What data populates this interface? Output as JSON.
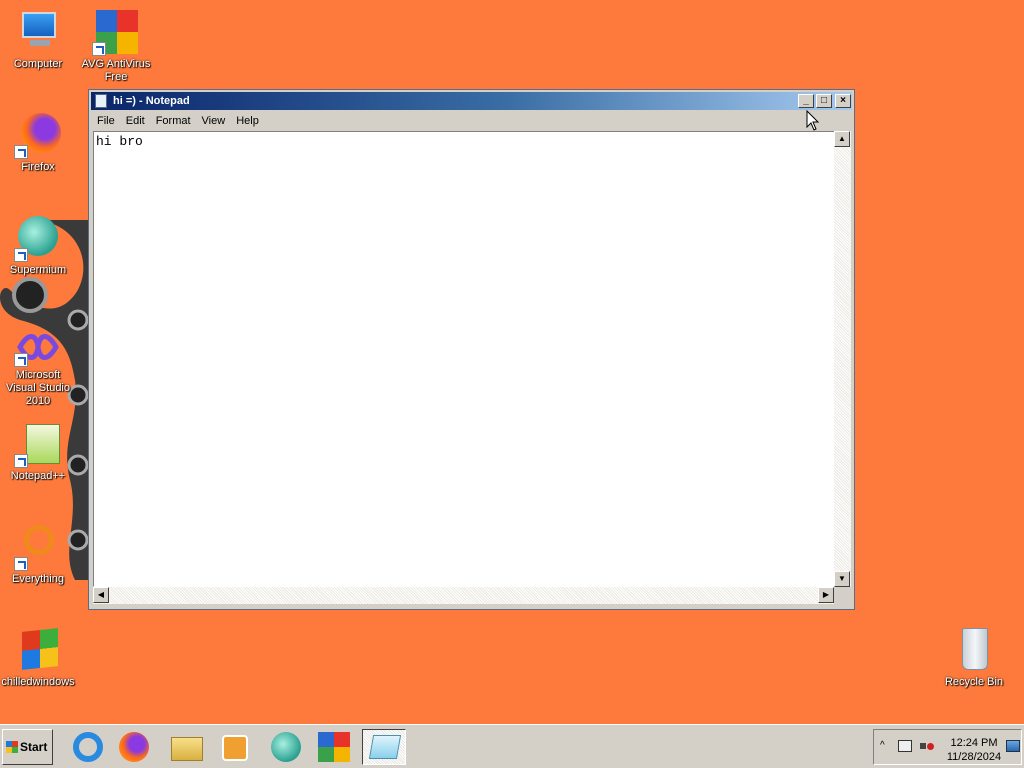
{
  "desktop": {
    "icons_left": [
      {
        "label": "Computer",
        "icon": "computer-icon"
      },
      {
        "label": "Firefox",
        "icon": "firefox-icon"
      },
      {
        "label": "Supermium",
        "icon": "supermium-icon"
      },
      {
        "label": "Microsoft Visual Studio 2010",
        "icon": "visual-studio-icon"
      },
      {
        "label": "Notepad++",
        "icon": "notepadpp-icon"
      },
      {
        "label": "Everything",
        "icon": "everything-icon"
      },
      {
        "label": "chilledwindows",
        "icon": "windows-flag-icon"
      }
    ],
    "avg": {
      "label": "AVG AntiVirus Free",
      "icon": "avg-icon"
    },
    "recycle": {
      "label": "Recycle Bin",
      "icon": "recycle-bin-icon"
    }
  },
  "notepad": {
    "title": "hi =) - Notepad",
    "menu": [
      "File",
      "Edit",
      "Format",
      "View",
      "Help"
    ],
    "content": "hi bro"
  },
  "taskbar": {
    "start_label": "Start",
    "apps": [
      "internet-explorer-icon",
      "firefox-icon",
      "file-explorer-icon",
      "media-player-icon",
      "supermium-icon",
      "avg-icon",
      "notepad-icon"
    ],
    "active_app": "notepad-icon"
  },
  "tray": {
    "time": "12:24 PM",
    "date": "11/28/2024",
    "icons": [
      "show-hidden-icons-icon",
      "network-icon",
      "volume-muted-icon",
      "show-desktop-icon"
    ]
  }
}
